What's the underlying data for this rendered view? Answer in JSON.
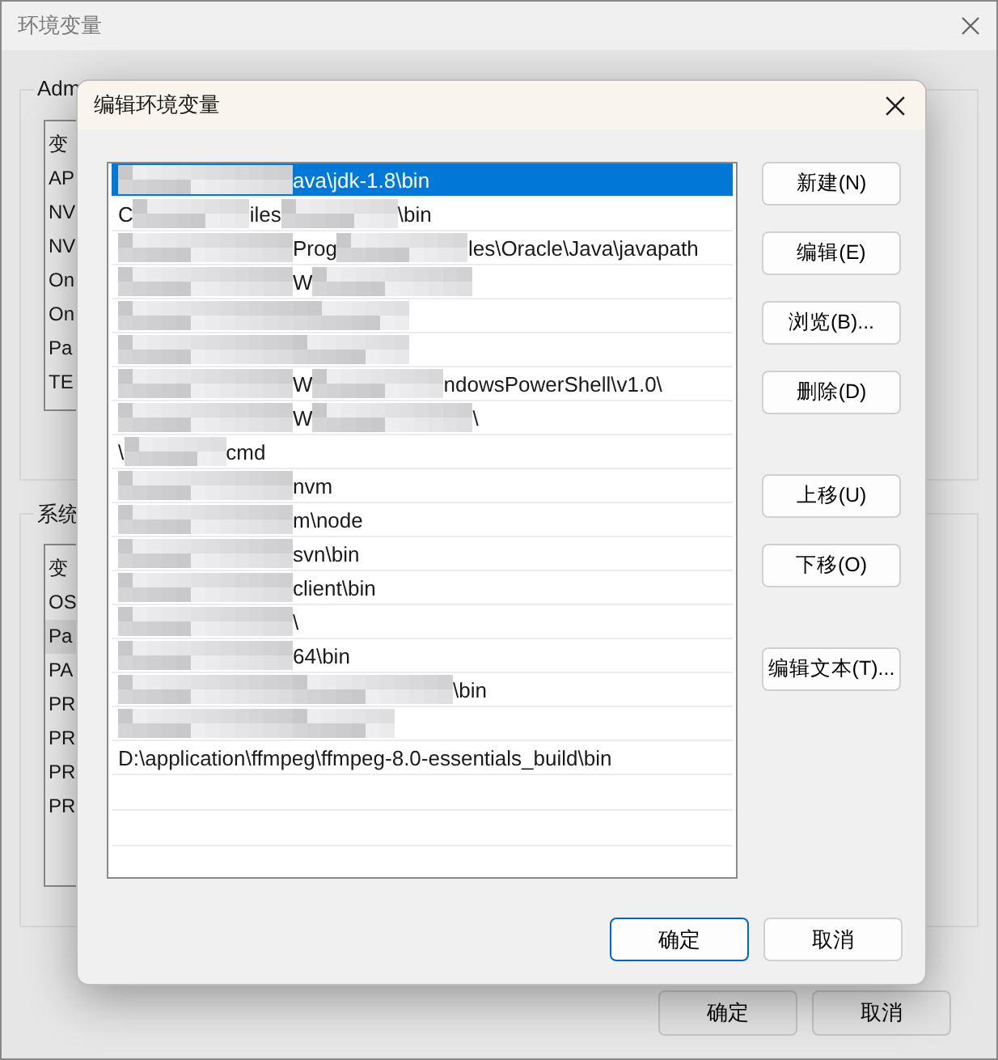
{
  "window": {
    "title": "环境变量",
    "user_group": {
      "label": "Adm",
      "header": "变",
      "rows": [
        "AP",
        "NV",
        "NV",
        "On",
        "On",
        "Pa",
        "TE"
      ]
    },
    "system_group": {
      "label": "系统",
      "header": "变",
      "rows": [
        {
          "name": "OS",
          "selected": false
        },
        {
          "name": "Pa",
          "selected": true
        },
        {
          "name": "PA",
          "selected": false
        },
        {
          "name": "PR",
          "selected": false
        },
        {
          "name": "PR",
          "selected": false
        },
        {
          "name": "PR",
          "selected": false
        },
        {
          "name": "PR",
          "selected": false
        }
      ]
    },
    "buttons": [
      "确定",
      "取消"
    ]
  },
  "dialog": {
    "title": "编辑环境变量",
    "paths": [
      {
        "selected": true,
        "parts": [
          {
            "kind": "mask"
          },
          {
            "kind": "text",
            "text": "ava\\jdk-1.8\\bin"
          }
        ]
      },
      {
        "selected": false,
        "parts": [
          {
            "kind": "text",
            "text": "C"
          },
          {
            "kind": "mask"
          },
          {
            "kind": "text",
            "text": "iles"
          },
          {
            "kind": "mask"
          },
          {
            "kind": "text",
            "text": "\\bin"
          }
        ]
      },
      {
        "selected": false,
        "parts": [
          {
            "kind": "mask"
          },
          {
            "kind": "text",
            "text": "Prog"
          },
          {
            "kind": "mask"
          },
          {
            "kind": "text",
            "text": "les\\Oracle\\Java\\javapath"
          }
        ]
      },
      {
        "selected": false,
        "parts": [
          {
            "kind": "mask"
          },
          {
            "kind": "text",
            "text": "W"
          },
          {
            "kind": "mask"
          }
        ]
      },
      {
        "selected": false,
        "parts": [
          {
            "kind": "mask"
          }
        ]
      },
      {
        "selected": false,
        "parts": [
          {
            "kind": "mask"
          },
          {
            "kind": "mask"
          }
        ]
      },
      {
        "selected": false,
        "parts": [
          {
            "kind": "mask"
          },
          {
            "kind": "text",
            "text": "W"
          },
          {
            "kind": "mask"
          },
          {
            "kind": "text",
            "text": "ndowsPowerShell\\v1.0\\"
          }
        ]
      },
      {
        "selected": false,
        "parts": [
          {
            "kind": "mask"
          },
          {
            "kind": "text",
            "text": "W"
          },
          {
            "kind": "mask"
          },
          {
            "kind": "text",
            "text": "\\"
          }
        ]
      },
      {
        "selected": false,
        "parts": [
          {
            "kind": "text",
            "text": "\\"
          },
          {
            "kind": "mask"
          },
          {
            "kind": "text",
            "text": "cmd"
          }
        ]
      },
      {
        "selected": false,
        "parts": [
          {
            "kind": "mask"
          },
          {
            "kind": "text",
            "text": "nvm"
          }
        ]
      },
      {
        "selected": false,
        "parts": [
          {
            "kind": "mask"
          },
          {
            "kind": "text",
            "text": "m\\node"
          }
        ]
      },
      {
        "selected": false,
        "parts": [
          {
            "kind": "mask"
          },
          {
            "kind": "text",
            "text": "svn\\bin"
          }
        ]
      },
      {
        "selected": false,
        "parts": [
          {
            "kind": "mask"
          },
          {
            "kind": "text",
            "text": "client\\bin"
          }
        ]
      },
      {
        "selected": false,
        "parts": [
          {
            "kind": "mask"
          },
          {
            "kind": "text",
            "text": "\\"
          }
        ]
      },
      {
        "selected": false,
        "parts": [
          {
            "kind": "mask"
          },
          {
            "kind": "text",
            "text": "64\\bin"
          }
        ]
      },
      {
        "selected": false,
        "parts": [
          {
            "kind": "mask"
          },
          {
            "kind": "mask"
          },
          {
            "kind": "text",
            "text": "\\bin"
          }
        ]
      },
      {
        "selected": false,
        "parts": [
          {
            "kind": "mask"
          },
          {
            "kind": "mask"
          }
        ]
      },
      {
        "selected": false,
        "parts": [
          {
            "kind": "text",
            "text": "D:\\application\\ffmpeg\\ffmpeg-8.0-essentials_build\\bin"
          }
        ]
      }
    ],
    "side_button_groups": [
      [
        "新建(N)",
        "编辑(E)",
        "浏览(B)...",
        "删除(D)"
      ],
      [
        "上移(U)",
        "下移(O)"
      ],
      [
        "编辑文本(T)..."
      ]
    ],
    "footer_buttons": [
      {
        "label": "确定",
        "default": true
      },
      {
        "label": "取消",
        "default": false
      }
    ]
  }
}
